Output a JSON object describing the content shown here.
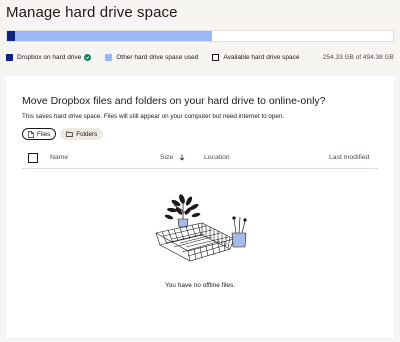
{
  "page": {
    "title": "Manage hard drive space"
  },
  "usage": {
    "dropbox_fraction": 0.02,
    "other_fraction": 0.51,
    "colors": {
      "dropbox": "#0d2481",
      "other": "#99b8f4",
      "available": "#ffffff"
    },
    "legend": {
      "dropbox": "Dropbox on hard drive",
      "other": "Other hard drive space used",
      "available": "Available hard drive space"
    },
    "total": "254.33 GB of 494.38 GB"
  },
  "card": {
    "heading": "Move Dropbox files and folders on your hard drive to online-only?",
    "description": "This saves hard drive space. Files will still appear on your computer but need internet to open.",
    "chips": {
      "files": "Files",
      "folders": "Folders"
    },
    "table": {
      "columns": {
        "name": "Name",
        "size": "Size",
        "location": "Location",
        "modified": "Last modified"
      }
    },
    "empty_message": "You have no offline files."
  }
}
